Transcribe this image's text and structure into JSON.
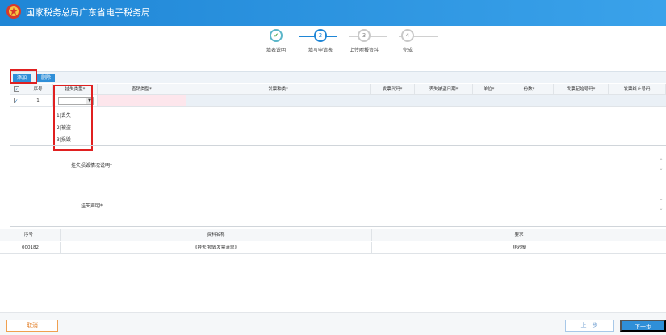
{
  "header": {
    "title": "国家税务总局广东省电子税务局"
  },
  "steps": [
    {
      "num": "✔",
      "label": "填表说明",
      "state": "done"
    },
    {
      "num": "2",
      "label": "填写申请表",
      "state": "active"
    },
    {
      "num": "3",
      "label": "上传附报资料",
      "state": "todo"
    },
    {
      "num": "4",
      "label": "完成",
      "state": "todo"
    }
  ],
  "toolbar": {
    "add_label": "添加",
    "delete_label": "删除"
  },
  "grid": {
    "columns": [
      "",
      "序号",
      "挂失类型*",
      "查销类型*",
      "发票种类*",
      "发票代码*",
      "丢失被盗日期*",
      "单位*",
      "份数*",
      "发票起始号码*",
      "发票终止号码"
    ],
    "row": {
      "index": "1"
    }
  },
  "dropdown": {
    "options": [
      "1|丢失",
      "2|被盗",
      "3|损毁"
    ]
  },
  "form": {
    "desc_label": "挂失损毁情况说明*",
    "statement_label": "挂失声明*"
  },
  "docs": {
    "columns": [
      "序号",
      "资料名称",
      "要求"
    ],
    "rows": [
      {
        "id": "000182",
        "name": "《挂失/损毁发票清单》",
        "req": "非必报"
      }
    ]
  },
  "footer": {
    "cancel_label": "取消",
    "prev_label": "上一步",
    "next_label": "下一步"
  }
}
